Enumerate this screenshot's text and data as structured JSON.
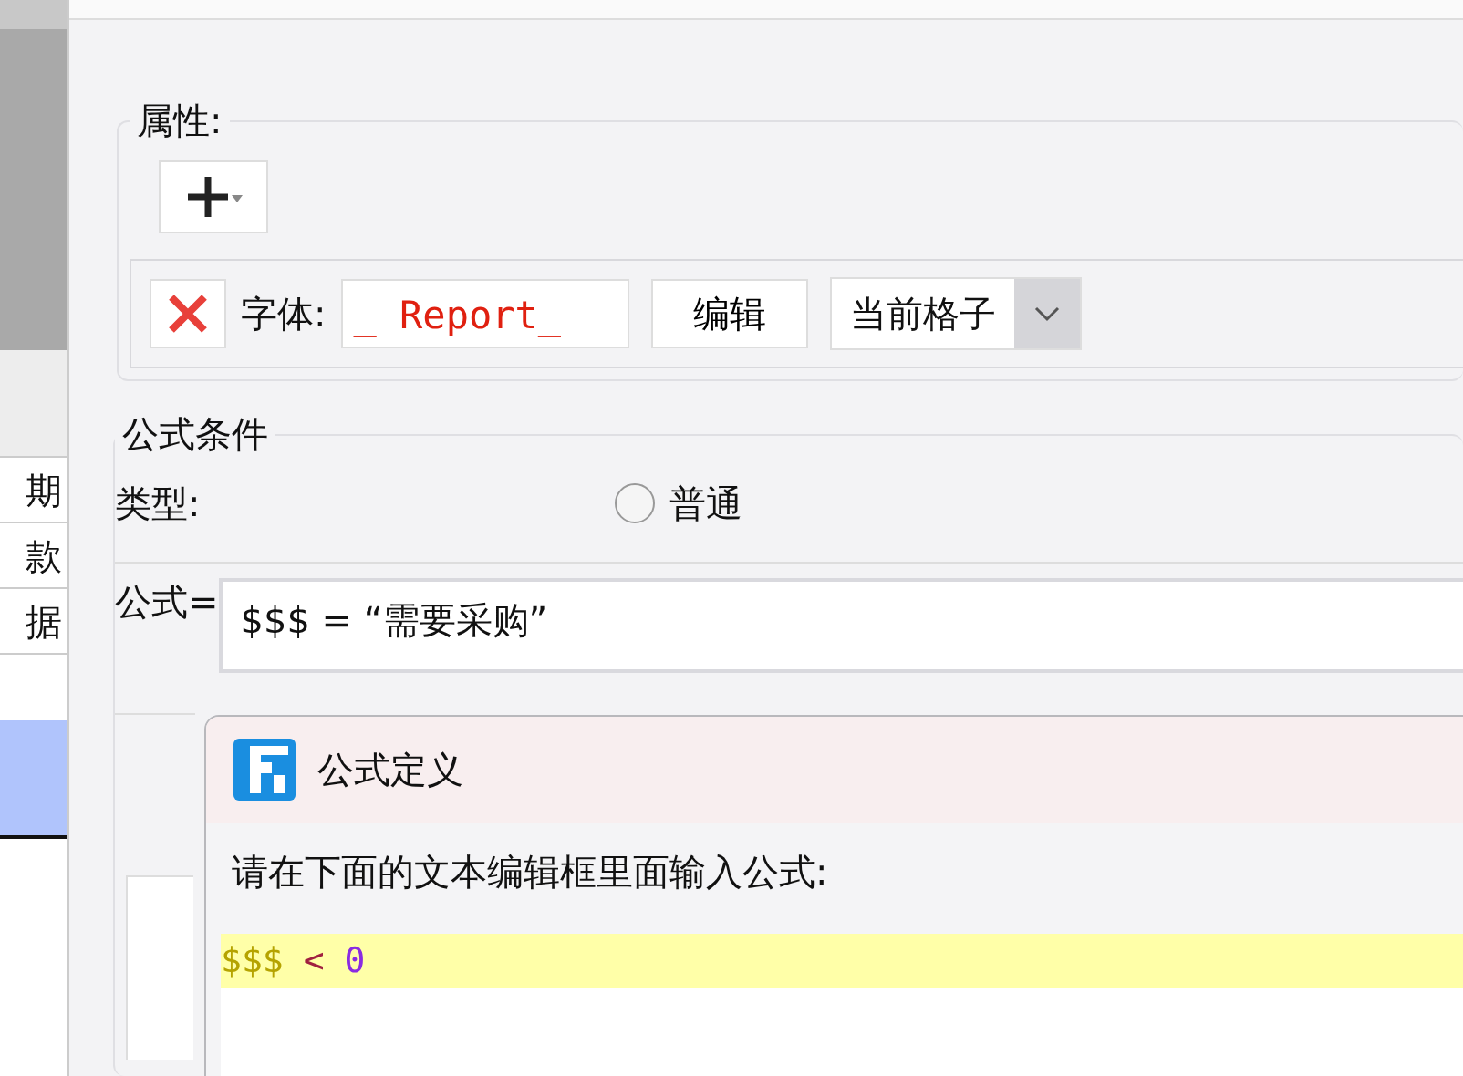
{
  "sheet": {
    "cells": [
      {
        "text": "期",
        "selected": false
      },
      {
        "text": "款",
        "selected": false
      },
      {
        "text": "据",
        "selected": false
      },
      {
        "text": "",
        "selected": true
      }
    ]
  },
  "properties": {
    "legend": "属性:",
    "font_label": "字体:",
    "font_value": "_ Report_",
    "edit_button": "编辑",
    "scope": "当前格子"
  },
  "formula_condition": {
    "legend": "公式条件",
    "type_label": "类型:",
    "options": [
      {
        "label": "普通",
        "selected": false
      }
    ],
    "formula_label": "公式=",
    "formula": "$$$ = “需要采购”"
  },
  "dialog": {
    "title": "公式定义",
    "prompt": "请在下面的文本编辑框里面输入公式:",
    "lines": [
      {
        "highlighted": true,
        "tokens": [
          {
            "kind": "variable",
            "text": "$$$"
          },
          {
            "kind": "operator",
            "text": "<"
          },
          {
            "kind": "number",
            "text": "0"
          }
        ]
      }
    ]
  }
}
